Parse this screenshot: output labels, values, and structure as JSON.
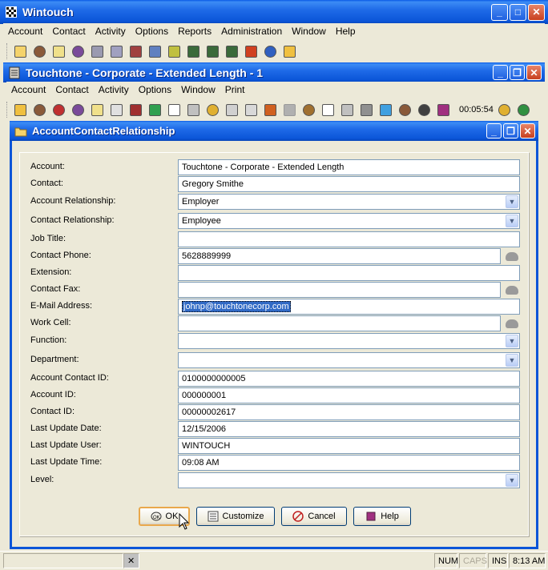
{
  "app": {
    "title": "Wintouch",
    "menu": [
      "Account",
      "Contact",
      "Activity",
      "Options",
      "Reports",
      "Administration",
      "Window",
      "Help"
    ]
  },
  "child_window": {
    "title": "Touchtone - Corporate - Extended Length - 1",
    "menu": [
      "Account",
      "Contact",
      "Activity",
      "Options",
      "Window",
      "Print"
    ],
    "timer": "00:05:54"
  },
  "dialog": {
    "title": "AccountContactRelationship",
    "fields": {
      "account": {
        "label": "Account:",
        "value": "Touchtone - Corporate - Extended Length"
      },
      "contact": {
        "label": "Contact:",
        "value": "Gregory Smithe"
      },
      "account_relationship": {
        "label": "Account Relationship:",
        "value": "Employer"
      },
      "contact_relationship": {
        "label": "Contact Relationship:",
        "value": "Employee"
      },
      "job_title": {
        "label": "Job Title:",
        "value": ""
      },
      "contact_phone": {
        "label": "Contact Phone:",
        "value": "5628889999"
      },
      "extension": {
        "label": "Extension:",
        "value": ""
      },
      "contact_fax": {
        "label": "Contact Fax:",
        "value": ""
      },
      "email": {
        "label": "E-Mail Address:",
        "value": "johnp@touchtonecorp.com"
      },
      "work_cell": {
        "label": "Work Cell:",
        "value": ""
      },
      "function": {
        "label": "Function:",
        "value": ""
      },
      "department": {
        "label": "Department:",
        "value": ""
      },
      "account_contact_id": {
        "label": "Account Contact ID:",
        "value": "0100000000005"
      },
      "account_id": {
        "label": "Account ID:",
        "value": "000000001"
      },
      "contact_id": {
        "label": "Contact ID:",
        "value": "00000002617"
      },
      "last_update_date": {
        "label": "Last Update Date:",
        "value": "12/15/2006"
      },
      "last_update_user": {
        "label": "Last Update User:",
        "value": "WINTOUCH"
      },
      "last_update_time": {
        "label": "Last Update Time:",
        "value": "09:08 AM"
      },
      "level": {
        "label": "Level:",
        "value": ""
      }
    },
    "buttons": {
      "ok": "OK",
      "customize": "Customize",
      "cancel": "Cancel",
      "help": "Help"
    }
  },
  "status": {
    "num": "NUM",
    "caps": "CAPS",
    "ins": "INS",
    "time": "8:13 AM"
  }
}
